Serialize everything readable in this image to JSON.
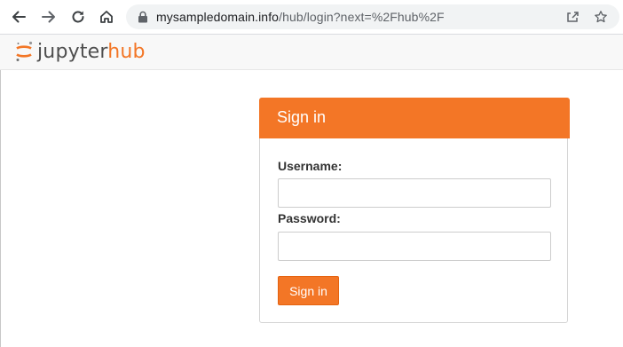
{
  "browser": {
    "url_host": "mysampledomain.info",
    "url_path": "/hub/login?next=%2Fhub%2F",
    "icons": {
      "back": "arrow-left-icon",
      "forward": "arrow-right-icon",
      "reload": "reload-icon",
      "home": "home-icon",
      "lock": "lock-icon",
      "share": "share-icon",
      "bookmark": "star-icon"
    }
  },
  "header": {
    "logo_jupyter": "jupyter",
    "logo_hub": "hub"
  },
  "login": {
    "title": "Sign in",
    "username_label": "Username:",
    "username_value": "",
    "password_label": "Password:",
    "password_value": "",
    "submit_label": "Sign in"
  },
  "colors": {
    "accent": "#f37626",
    "header_bg": "#f8f8f8",
    "text": "#333333"
  }
}
